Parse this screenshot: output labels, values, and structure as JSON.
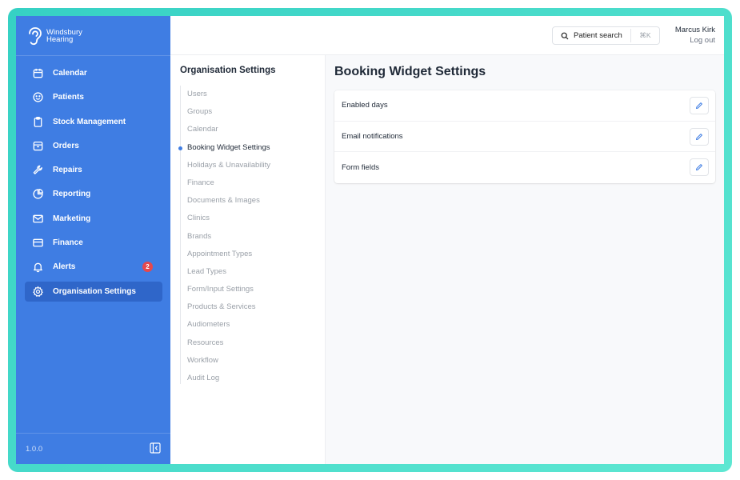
{
  "brand": {
    "name_line1": "Windsbury",
    "name_line2": "Hearing"
  },
  "sidebar": {
    "items": [
      {
        "label": "Calendar",
        "icon": "calendar-icon"
      },
      {
        "label": "Patients",
        "icon": "smiley-icon"
      },
      {
        "label": "Stock Management",
        "icon": "clipboard-icon"
      },
      {
        "label": "Orders",
        "icon": "box-icon"
      },
      {
        "label": "Repairs",
        "icon": "wrench-icon"
      },
      {
        "label": "Reporting",
        "icon": "pie-chart-icon"
      },
      {
        "label": "Marketing",
        "icon": "mail-icon"
      },
      {
        "label": "Finance",
        "icon": "credit-card-icon"
      },
      {
        "label": "Alerts",
        "icon": "bell-icon",
        "badge": "2"
      },
      {
        "label": "Organisation Settings",
        "icon": "gear-icon",
        "active": true
      }
    ],
    "version": "1.0.0"
  },
  "header": {
    "search_label": "Patient search",
    "search_shortcut": "⌘K",
    "user_name": "Marcus Kirk",
    "logout_label": "Log out"
  },
  "settings_nav": {
    "title": "Organisation Settings",
    "items": [
      "Users",
      "Groups",
      "Calendar",
      "Booking Widget Settings",
      "Holidays & Unavailability",
      "Finance",
      "Documents & Images",
      "Clinics",
      "Brands",
      "Appointment Types",
      "Lead Types",
      "Form/Input Settings",
      "Products & Services",
      "Audiometers",
      "Resources",
      "Workflow",
      "Audit Log"
    ],
    "active_index": 3
  },
  "main": {
    "title": "Booking Widget Settings",
    "rows": [
      {
        "label": "Enabled days"
      },
      {
        "label": "Email notifications"
      },
      {
        "label": "Form fields"
      }
    ]
  },
  "colors": {
    "sidebar": "#3f7de3",
    "sidebar_active": "#2f66c9",
    "accent": "#3f7de3",
    "badge": "#e5484d",
    "frame": "#36d1c4"
  }
}
